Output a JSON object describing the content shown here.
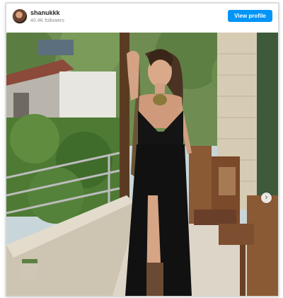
{
  "profile": {
    "username": "shanukkk",
    "followers": "40.4K followers",
    "view_profile_label": "View profile"
  },
  "carousel": {
    "next_icon": "chevron-right-icon",
    "next_glyph": "›"
  },
  "colors": {
    "button_blue": "#0095f6",
    "username_text": "#262626",
    "muted_text": "#8e8e8e"
  }
}
